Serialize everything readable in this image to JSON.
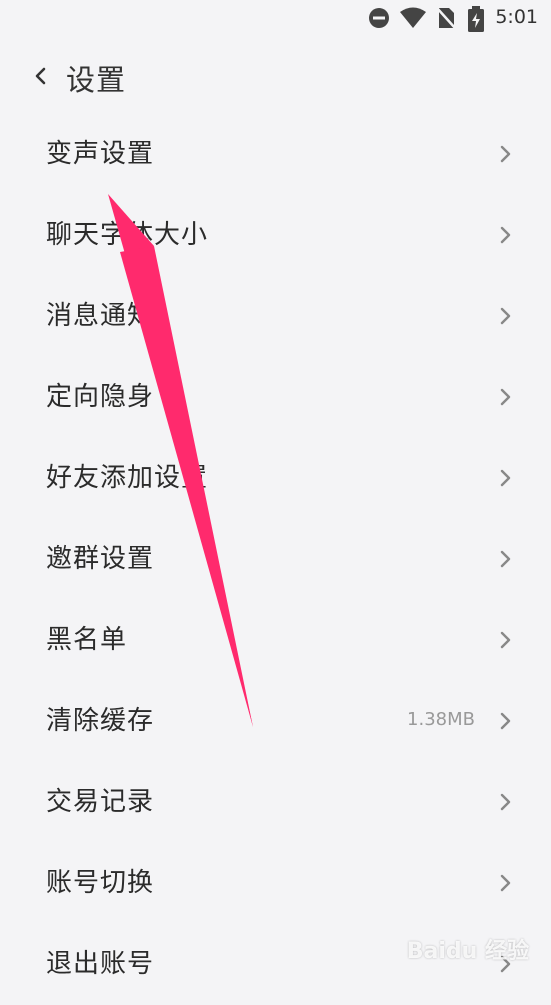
{
  "status": {
    "time": "5:01"
  },
  "header": {
    "title": "设置"
  },
  "menu": [
    {
      "label": "变声设置"
    },
    {
      "label": "聊天字体大小"
    },
    {
      "label": "消息通知"
    },
    {
      "label": "定向隐身"
    },
    {
      "label": "好友添加设置"
    },
    {
      "label": "邀群设置"
    },
    {
      "label": "黑名单"
    },
    {
      "label": "清除缓存",
      "value": "1.38MB"
    },
    {
      "label": "交易记录"
    },
    {
      "label": "账号切换"
    },
    {
      "label": "退出账号"
    }
  ],
  "colors": {
    "annotation_arrow": "#ff2a6d",
    "background": "#f4f4f6"
  },
  "watermark": "Baidu 经验"
}
